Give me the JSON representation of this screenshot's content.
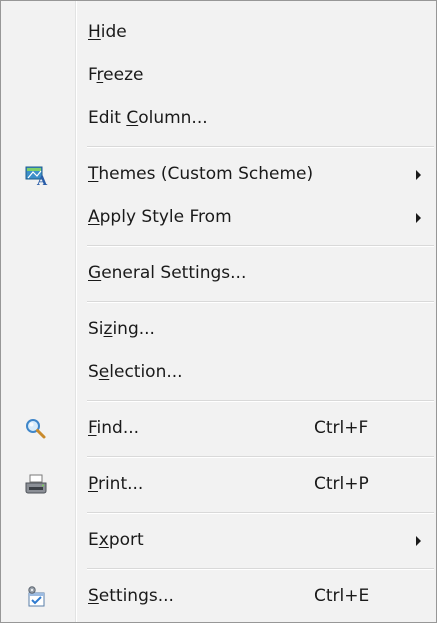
{
  "menu": {
    "items": [
      {
        "pre": "",
        "key": "H",
        "post": "ide",
        "shortcut": "",
        "submenu": false,
        "icon": ""
      },
      {
        "pre": "F",
        "key": "r",
        "post": "eeze",
        "shortcut": "",
        "submenu": false,
        "icon": ""
      },
      {
        "pre": "Edit ",
        "key": "C",
        "post": "olumn...",
        "shortcut": "",
        "submenu": false,
        "icon": ""
      },
      {
        "pre": "",
        "key": "T",
        "post": "hemes (Custom Scheme)",
        "shortcut": "",
        "submenu": true,
        "icon": "themes-icon"
      },
      {
        "pre": "",
        "key": "A",
        "post": "pply Style From",
        "shortcut": "",
        "submenu": true,
        "icon": ""
      },
      {
        "pre": "",
        "key": "G",
        "post": "eneral Settings...",
        "shortcut": "",
        "submenu": false,
        "icon": ""
      },
      {
        "pre": "Si",
        "key": "z",
        "post": "ing...",
        "shortcut": "",
        "submenu": false,
        "icon": ""
      },
      {
        "pre": "S",
        "key": "e",
        "post": "lection...",
        "shortcut": "",
        "submenu": false,
        "icon": ""
      },
      {
        "pre": "",
        "key": "F",
        "post": "ind...",
        "shortcut": "Ctrl+F",
        "submenu": false,
        "icon": "magnifier-icon"
      },
      {
        "pre": "",
        "key": "P",
        "post": "rint...",
        "shortcut": "Ctrl+P",
        "submenu": false,
        "icon": "printer-icon"
      },
      {
        "pre": "E",
        "key": "x",
        "post": "port",
        "shortcut": "",
        "submenu": true,
        "icon": ""
      },
      {
        "pre": "",
        "key": "S",
        "post": "ettings...",
        "shortcut": "Ctrl+E",
        "submenu": false,
        "icon": "settings-icon"
      }
    ]
  }
}
